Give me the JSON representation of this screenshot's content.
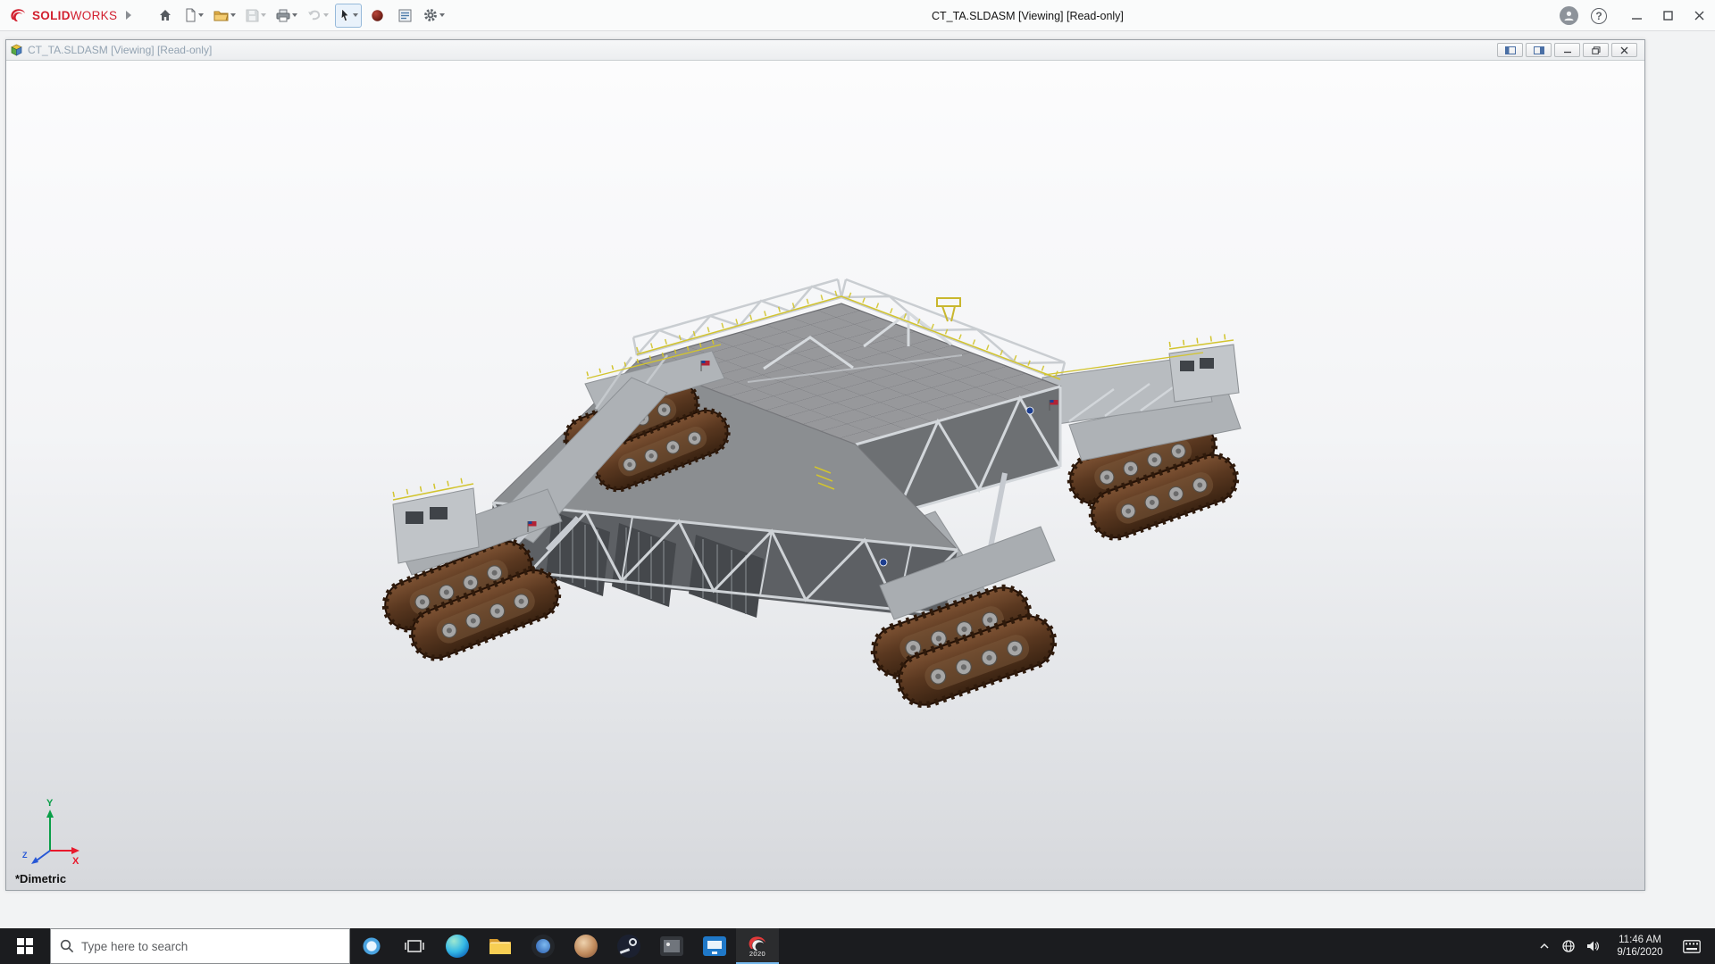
{
  "colors": {
    "accent_red": "#d2202f",
    "taskbar_bg": "#1b1c1f",
    "track_brown": "#5a3820",
    "deck_gray": "#97989b",
    "truss_light": "#ced2d6",
    "viewport_gradient_top": "#fcfcfd",
    "viewport_gradient_bottom": "#d6d8dc",
    "axis_x_red": "#e8192c",
    "axis_y_green": "#0a9e48",
    "axis_z_blue": "#2757d6"
  },
  "app": {
    "brand": {
      "name_bold": "SOLID",
      "name_light": "WORKS"
    },
    "title": "CT_TA.SLDASM [Viewing] [Read-only]",
    "help_glyph": "?",
    "toolbar_icons": [
      "home",
      "new-document",
      "open",
      "save",
      "print",
      "undo",
      "select-cursor",
      "xpert-sphere",
      "report",
      "options-gear"
    ]
  },
  "doc": {
    "title": "CT_TA.SLDASM [Viewing] [Read-only]"
  },
  "viewport": {
    "view_name": "*Dimetric",
    "axes": {
      "x": "X",
      "y": "Y",
      "z": "Z"
    }
  },
  "taskbar": {
    "search_placeholder": "Type here to search",
    "pinned_icons": [
      "cortana",
      "task-view",
      "edge",
      "file-explorer",
      "browser",
      "photos",
      "steam",
      "image-viewer",
      "blue-app",
      "solidworks"
    ],
    "solidworks_badge": "2020",
    "clock": {
      "time": "11:46 AM",
      "date": "9/16/2020"
    }
  }
}
